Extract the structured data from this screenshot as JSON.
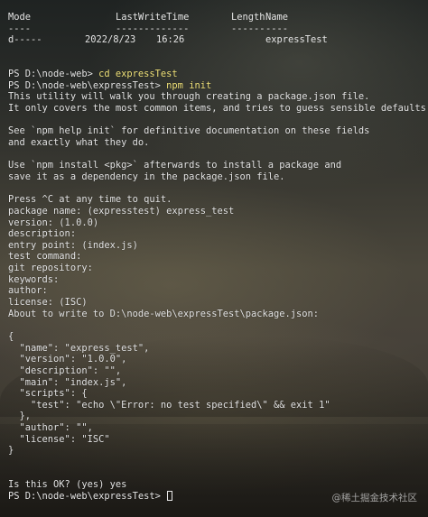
{
  "header": {
    "col_mode": "Mode",
    "col_lastwritetime": "LastWriteTime",
    "col_length": "Length",
    "col_name": "Name",
    "sep_mode": "----",
    "sep_lastwritetime": "-------------",
    "sep_length": "------",
    "sep_name": "----"
  },
  "entry": {
    "mode": "d-----",
    "date": "2022/8/23",
    "time": "16:26",
    "name": "expressTest"
  },
  "cmd1": {
    "prompt": "PS D:\\node-web> ",
    "command": "cd expressTest"
  },
  "cmd2": {
    "prompt": "PS D:\\node-web\\expressTest> ",
    "command": "npm init"
  },
  "output": {
    "l1": "This utility will walk you through creating a package.json file.",
    "l2": "It only covers the most common items, and tries to guess sensible defaults.",
    "l3": "See `npm help init` for definitive documentation on these fields",
    "l4": "and exactly what they do.",
    "l5": "Use `npm install <pkg>` afterwards to install a package and",
    "l6": "save it as a dependency in the package.json file.",
    "l7": "Press ^C at any time to quit.",
    "l8": "package name: (expresstest) express_test",
    "l9": "version: (1.0.0)",
    "l10": "description:",
    "l11": "entry point: (index.js)",
    "l12": "test command:",
    "l13": "git repository:",
    "l14": "keywords:",
    "l15": "author:",
    "l16": "license: (ISC)",
    "l17": "About to write to D:\\node-web\\expressTest\\package.json:"
  },
  "json": {
    "j1": "{",
    "j2": "  \"name\": \"express_test\",",
    "j3": "  \"version\": \"1.0.0\",",
    "j4": "  \"description\": \"\",",
    "j5": "  \"main\": \"index.js\",",
    "j6": "  \"scripts\": {",
    "j7": "    \"test\": \"echo \\\"Error: no test specified\\\" && exit 1\"",
    "j8": "  },",
    "j9": "  \"author\": \"\",",
    "j10": "  \"license\": \"ISC\"",
    "j11": "}"
  },
  "confirm": "Is this OK? (yes) yes",
  "final_prompt": "PS D:\\node-web\\expressTest> ",
  "watermark": "@稀土掘金技术社区"
}
